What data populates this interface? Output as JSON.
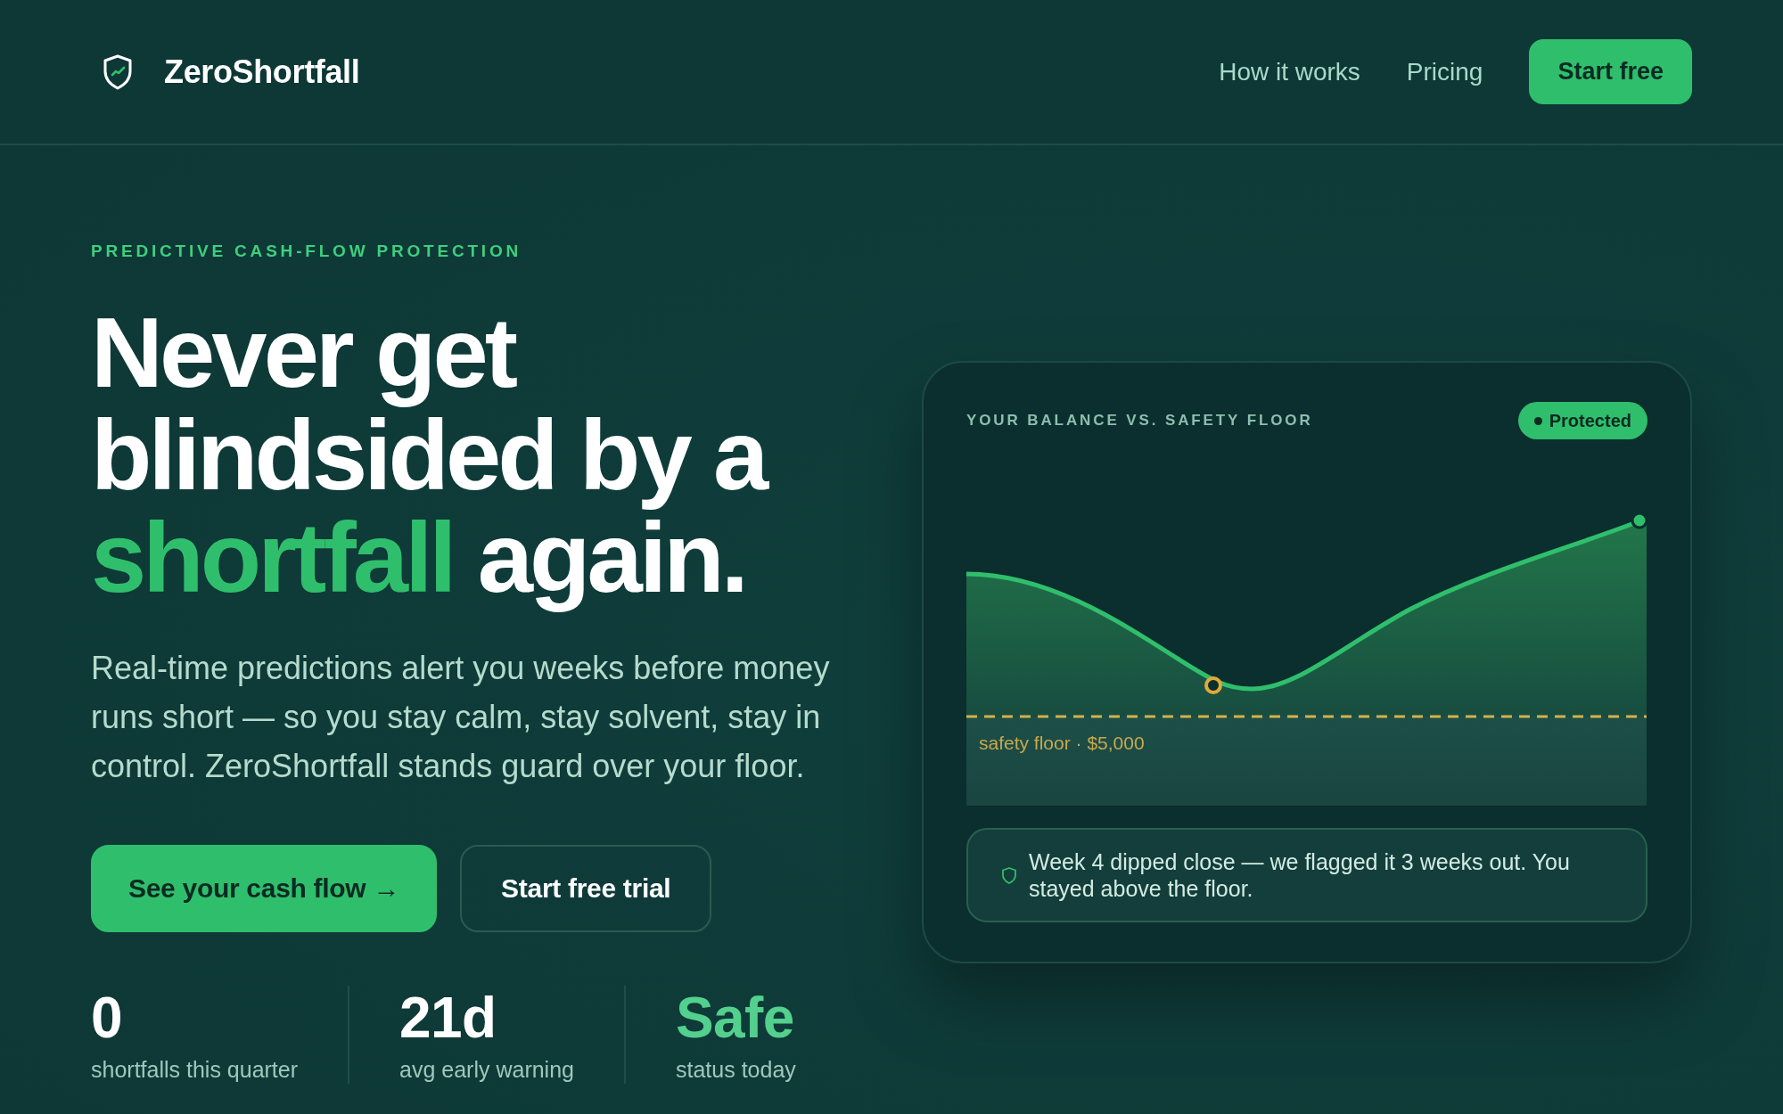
{
  "header": {
    "brand": "ZeroShortfall",
    "nav_links": [
      "How it works",
      "Pricing"
    ],
    "cta": "Start free"
  },
  "hero": {
    "eyebrow": "PREDICTIVE CASH-FLOW PROTECTION",
    "headline": [
      {
        "text": "Never get blindsided by a",
        "highlight": false
      },
      {
        "text": "shortfall",
        "highlight": true
      },
      {
        "text": "again.",
        "highlight": false
      }
    ],
    "description": "Real-time predictions alert you weeks before money runs short — so you stay calm, stay solvent, stay in control. ZeroShortfall stands guard over your floor.",
    "buttons": [
      {
        "label": "See your cash flow →",
        "kind": "primary"
      },
      {
        "label": "Start free trial",
        "kind": "secondary"
      }
    ],
    "stats": [
      {
        "value": "0",
        "label": "shortfalls this quarter",
        "highlight": false
      },
      {
        "value": "21d",
        "label": "avg early warning",
        "highlight": false
      },
      {
        "value": "Safe",
        "label": "status today",
        "highlight": true
      }
    ]
  },
  "balance_card": {
    "title": "YOUR BALANCE VS. SAFETY FLOOR",
    "status_badge": "Protected",
    "floor_label": "safety floor · $5,000",
    "note": "Week 4 dipped close — we flagged it 3 weeks out. You stayed above the floor."
  }
}
